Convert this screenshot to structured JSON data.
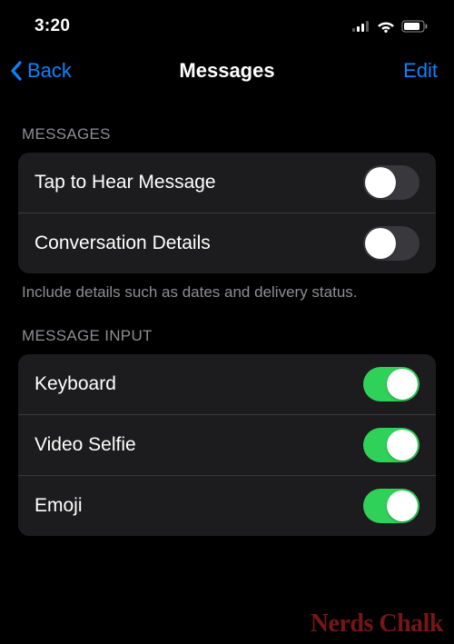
{
  "status": {
    "time": "3:20"
  },
  "nav": {
    "back": "Back",
    "title": "Messages",
    "edit": "Edit"
  },
  "sections": {
    "messages": {
      "header": "MESSAGES",
      "rows": [
        {
          "label": "Tap to Hear Message",
          "on": false
        },
        {
          "label": "Conversation Details",
          "on": false
        }
      ],
      "footer": "Include details such as dates and delivery status."
    },
    "input": {
      "header": "MESSAGE INPUT",
      "rows": [
        {
          "label": "Keyboard",
          "on": true
        },
        {
          "label": "Video Selfie",
          "on": true
        },
        {
          "label": "Emoji",
          "on": true
        }
      ]
    }
  },
  "watermark": "Nerds Chalk"
}
